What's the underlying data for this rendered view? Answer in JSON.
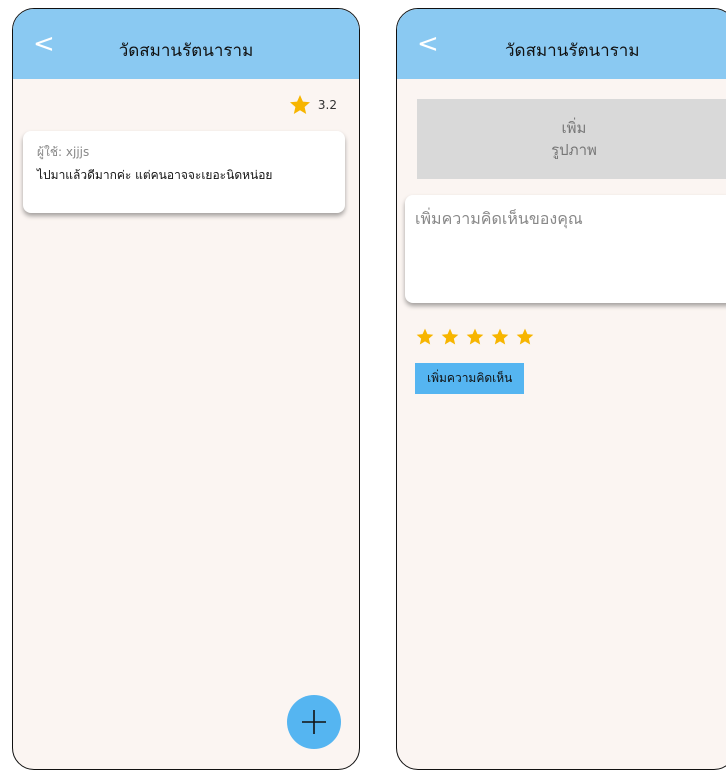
{
  "left_screen": {
    "back_label": "<",
    "title": "วัดสมานรัตนาราม",
    "rating_value": "3.2",
    "review": {
      "reviewer": "ผู้ใช้: xjjjs",
      "text": "ไปมาแล้วดีมากค่ะ แต่คนอาจจะเยอะนิดหน่อย"
    },
    "fab_icon": "plus-icon"
  },
  "right_screen": {
    "back_label": "<",
    "title": "วัดสมานรัตนาราม",
    "add_photo_line1": "เพิ่ม",
    "add_photo_line2": "รูปภาพ",
    "comment_placeholder": "เพิ่มความคิดเห็นของคุณ",
    "stars": 5,
    "submit_label": "เพิ่มความคิดเห็น"
  },
  "colors": {
    "appbar": "#8ac9f2",
    "background": "#fbf5f2",
    "star": "#f7b500",
    "accent": "#55b5f1"
  }
}
